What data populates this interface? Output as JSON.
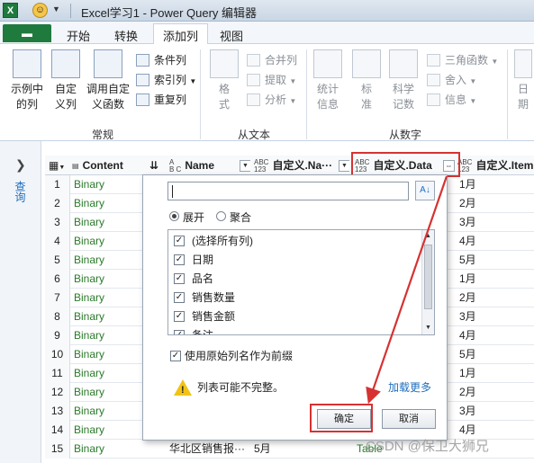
{
  "titlebar": {
    "app_icon": "X",
    "window_title": "Excel学习1 - Power Query 编辑器"
  },
  "tabs": {
    "file": "",
    "items": [
      "开始",
      "转换",
      "添加列",
      "视图"
    ],
    "active": "添加列"
  },
  "ribbon": {
    "group_general": {
      "label": "常规",
      "example_col": "示例中\n的列",
      "custom_col": "自定\n义列",
      "invoke_fn": "调用自定\n义函数",
      "conditional": "条件列",
      "index": "索引列",
      "duplicate": "重复列"
    },
    "group_text": {
      "label": "从文本",
      "format": "格\n式",
      "merge": "合并列",
      "extract": "提取",
      "parse": "分析"
    },
    "group_number": {
      "label": "从数字",
      "stats": "统计\n信息",
      "standard": "标\n准",
      "scientific": "科学\n记数",
      "trig": "三角函数",
      "round": "舍入",
      "info": "信息",
      "date": "日\n期"
    }
  },
  "leftpane": {
    "label": "查询"
  },
  "grid": {
    "headers": {
      "content": "Content",
      "name": "Name",
      "col_a": "自定义.Na···",
      "col_data": "自定义.Data",
      "col_item": "自定义.Item"
    },
    "rows": [
      {
        "n": "1",
        "content": "Binary",
        "month": "1月"
      },
      {
        "n": "2",
        "content": "Binary",
        "month": "2月"
      },
      {
        "n": "3",
        "content": "Binary",
        "month": "3月"
      },
      {
        "n": "4",
        "content": "Binary",
        "month": "4月"
      },
      {
        "n": "5",
        "content": "Binary",
        "month": "5月"
      },
      {
        "n": "6",
        "content": "Binary",
        "month": "1月"
      },
      {
        "n": "7",
        "content": "Binary",
        "month": "2月"
      },
      {
        "n": "8",
        "content": "Binary",
        "month": "3月"
      },
      {
        "n": "9",
        "content": "Binary",
        "month": "4月"
      },
      {
        "n": "10",
        "content": "Binary",
        "month": "5月"
      },
      {
        "n": "11",
        "content": "Binary",
        "month": "1月"
      },
      {
        "n": "12",
        "content": "Binary",
        "month": "2月"
      },
      {
        "n": "13",
        "content": "Binary",
        "month": "3月"
      },
      {
        "n": "14",
        "content": "Binary",
        "month": "4月"
      },
      {
        "n": "15",
        "content": "Binary",
        "month": ""
      }
    ],
    "last_row": {
      "name": "华北区销售报···",
      "col_a": "5月",
      "col_data": "Table"
    }
  },
  "dialog": {
    "search_value": "",
    "radio_expand": "展开",
    "radio_aggregate": "聚合",
    "columns": [
      "(选择所有列)",
      "日期",
      "品名",
      "销售数量",
      "销售金额",
      "备注"
    ],
    "prefix_label": "使用原始列名作为前缀",
    "warning": "列表可能不完整。",
    "load_more": "加载更多",
    "ok": "确定",
    "cancel": "取消"
  },
  "watermark": "CSDN @保卫大狮兄",
  "colors": {
    "accent_green": "#1f7a3d",
    "highlight_red": "#d63232",
    "link_blue": "#1f6fbf"
  }
}
